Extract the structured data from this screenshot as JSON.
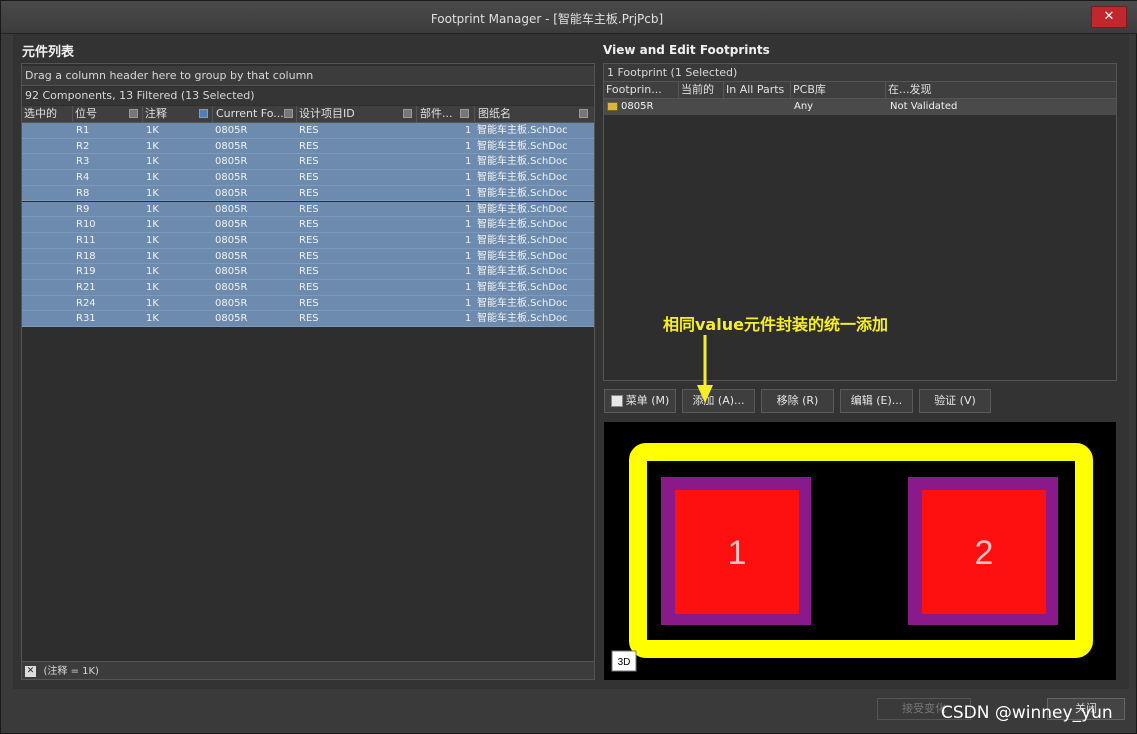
{
  "window": {
    "title": "Footprint Manager - [智能车主板.PrjPcb]",
    "close_label": "✕"
  },
  "left": {
    "title": "元件列表",
    "group_hint": "Drag a column header here to group by that column",
    "status": "92 Components, 13 Filtered (13 Selected)",
    "columns": [
      "选中的",
      "位号",
      "注释",
      "Current Fo...",
      "设计项目ID",
      "部件...",
      "图纸名"
    ],
    "rows": [
      {
        "des": "R1",
        "comment": "1K",
        "fp": "0805R",
        "id": "RES",
        "part": "1",
        "sheet": "智能车主板.SchDoc"
      },
      {
        "des": "R2",
        "comment": "1K",
        "fp": "0805R",
        "id": "RES",
        "part": "1",
        "sheet": "智能车主板.SchDoc"
      },
      {
        "des": "R3",
        "comment": "1K",
        "fp": "0805R",
        "id": "RES",
        "part": "1",
        "sheet": "智能车主板.SchDoc"
      },
      {
        "des": "R4",
        "comment": "1K",
        "fp": "0805R",
        "id": "RES",
        "part": "1",
        "sheet": "智能车主板.SchDoc"
      },
      {
        "des": "R8",
        "comment": "1K",
        "fp": "0805R",
        "id": "RES",
        "part": "1",
        "sheet": "智能车主板.SchDoc"
      },
      {
        "des": "R9",
        "comment": "1K",
        "fp": "0805R",
        "id": "RES",
        "part": "1",
        "sheet": "智能车主板.SchDoc"
      },
      {
        "des": "R10",
        "comment": "1K",
        "fp": "0805R",
        "id": "RES",
        "part": "1",
        "sheet": "智能车主板.SchDoc"
      },
      {
        "des": "R11",
        "comment": "1K",
        "fp": "0805R",
        "id": "RES",
        "part": "1",
        "sheet": "智能车主板.SchDoc"
      },
      {
        "des": "R18",
        "comment": "1K",
        "fp": "0805R",
        "id": "RES",
        "part": "1",
        "sheet": "智能车主板.SchDoc"
      },
      {
        "des": "R19",
        "comment": "1K",
        "fp": "0805R",
        "id": "RES",
        "part": "1",
        "sheet": "智能车主板.SchDoc"
      },
      {
        "des": "R21",
        "comment": "1K",
        "fp": "0805R",
        "id": "RES",
        "part": "1",
        "sheet": "智能车主板.SchDoc"
      },
      {
        "des": "R24",
        "comment": "1K",
        "fp": "0805R",
        "id": "RES",
        "part": "1",
        "sheet": "智能车主板.SchDoc"
      },
      {
        "des": "R31",
        "comment": "1K",
        "fp": "0805R",
        "id": "RES",
        "part": "1",
        "sheet": "智能车主板.SchDoc"
      }
    ],
    "filter_text": "(注释 = 1K)"
  },
  "right": {
    "title": "View and Edit Footprints",
    "status": "1 Footprint (1 Selected)",
    "columns": [
      "Footprin...",
      "当前的",
      "In All Parts",
      "PCB库",
      "在...发现"
    ],
    "row": {
      "name": "0805R",
      "pcb_lib": "Any",
      "found_in": "Not Validated"
    },
    "buttons": {
      "menu": "菜单 (M)",
      "add": "添加 (A)...",
      "remove": "移除 (R)",
      "edit": "编辑 (E)...",
      "validate": "验证 (V)"
    },
    "preview": {
      "pad1": "1",
      "pad2": "2",
      "badge_3d": "3D"
    }
  },
  "annotation": "相同value元件封装的统一添加",
  "footer": {
    "accept": "接受变化",
    "close": "关闭"
  },
  "watermark": "CSDN @winney_yun"
}
